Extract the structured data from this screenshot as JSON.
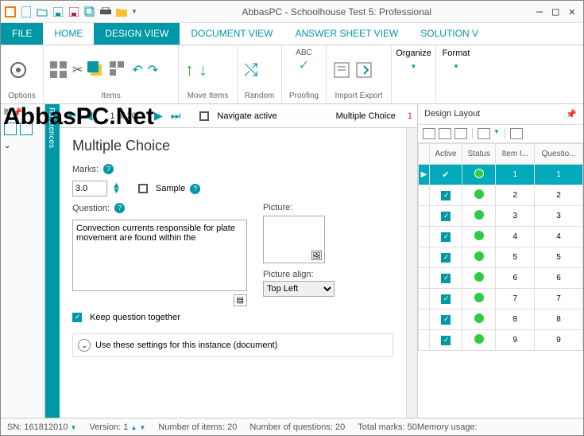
{
  "app": {
    "title": "AbbasPC - Schoolhouse Test 5: Professional"
  },
  "tabs": {
    "file": "FILE",
    "home": "HOME",
    "design": "DESIGN VIEW",
    "document": "DOCUMENT VIEW",
    "answer": "ANSWER SHEET VIEW",
    "solution": "SOLUTION V"
  },
  "ribbon": {
    "options": "Options",
    "items": "Items",
    "move": "Move Items",
    "random": "Random",
    "proofing": "Proofing",
    "import": "Import Export",
    "organize": "Organize",
    "format": "Format"
  },
  "watermark": "AbbasPC.Net",
  "nav": {
    "pos": "1 of 20",
    "navactive": "Navigate active",
    "type": "Multiple Choice",
    "idx": "1"
  },
  "sidetab": "References",
  "leftbar": {
    "lt": "lt"
  },
  "form": {
    "title": "Multiple Choice",
    "marks_label": "Marks:",
    "marks": "3.0",
    "sample": "Sample",
    "question_label": "Question:",
    "question": "Convection currents responsible for plate movement are found within the",
    "picture_label": "Picture:",
    "picalign_label": "Picture align:",
    "picalign": "Top Left",
    "keep": "Keep question together",
    "settings": "Use these settings for this instance (document)"
  },
  "right": {
    "title": "Design Layout",
    "cols": {
      "active": "Active",
      "status": "Status",
      "item": "Item I...",
      "quest": "Questio..."
    },
    "rows": [
      {
        "sel": true,
        "active": true,
        "item": "1",
        "q": "1"
      },
      {
        "sel": false,
        "active": true,
        "item": "2",
        "q": "2"
      },
      {
        "sel": false,
        "active": true,
        "item": "3",
        "q": "3"
      },
      {
        "sel": false,
        "active": true,
        "item": "4",
        "q": "4"
      },
      {
        "sel": false,
        "active": true,
        "item": "5",
        "q": "5"
      },
      {
        "sel": false,
        "active": true,
        "item": "6",
        "q": "6"
      },
      {
        "sel": false,
        "active": true,
        "item": "7",
        "q": "7"
      },
      {
        "sel": false,
        "active": true,
        "item": "8",
        "q": "8"
      },
      {
        "sel": false,
        "active": true,
        "item": "9",
        "q": "9"
      }
    ]
  },
  "status": {
    "sn_label": "SN:",
    "sn": "161812010",
    "ver_label": "Version:",
    "ver": "1",
    "items_label": "Number of items:",
    "items": "20",
    "q_label": "Number of questions:",
    "q": "20",
    "marks_label": "Total marks:",
    "marks": "50",
    "mem": "Memory usage:"
  }
}
